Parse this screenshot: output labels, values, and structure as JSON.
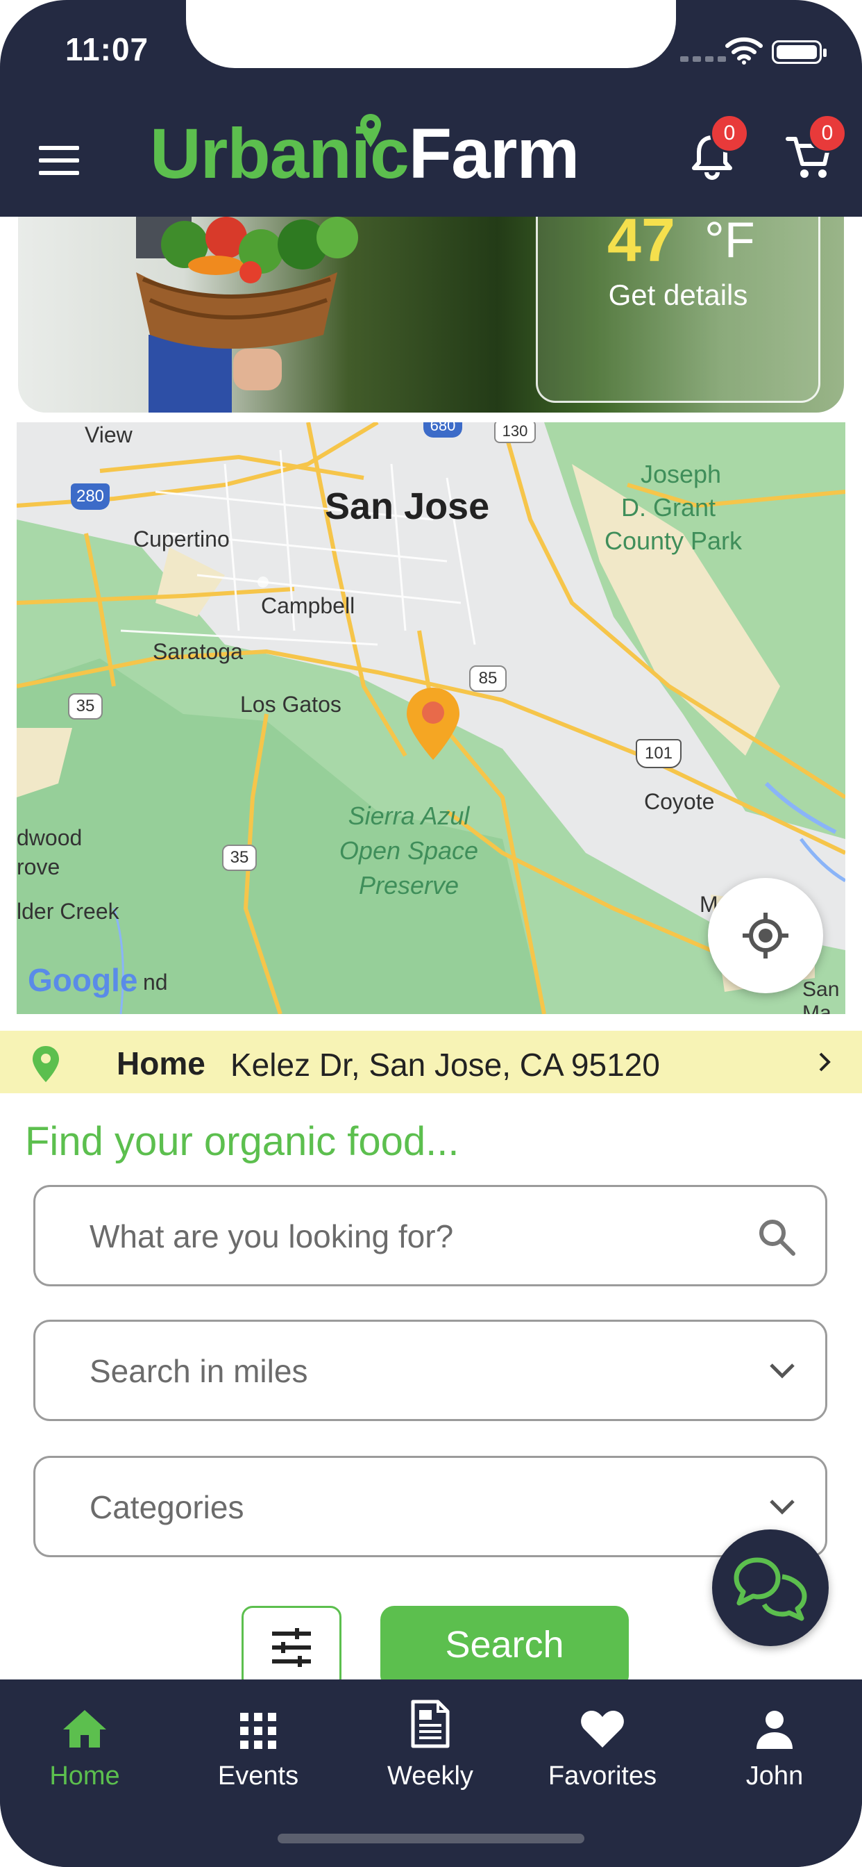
{
  "status_bar": {
    "time": "11:07"
  },
  "header": {
    "logo_part1": "Urbanic",
    "logo_part2": "Farm",
    "notification_count": "0",
    "cart_count": "0"
  },
  "weather": {
    "temperature": "47",
    "unit": "°F",
    "details_label": "Get details"
  },
  "map": {
    "labels": {
      "san_jose": "San Jose",
      "cupertino": "Cupertino",
      "campbell": "Campbell",
      "saratoga": "Saratoga",
      "los_gatos": "Los Gatos",
      "joseph1": "Joseph",
      "joseph2": "D. Grant",
      "joseph3": "County Park",
      "sierra1": "Sierra Azul",
      "sierra2": "Open Space",
      "sierra3": "Preserve",
      "coyote": "Coyote",
      "view": "View",
      "dwood": "dwood",
      "rove": "rove",
      "lder": "lder Creek",
      "nd": "nd",
      "san_ma": "San Ma",
      "m_ll": "M        ll",
      "h280": "280",
      "h130": "130",
      "h85": "85",
      "h35a": "35",
      "h35b": "35",
      "h101": "101",
      "h680": "680",
      "google": "Google"
    }
  },
  "address": {
    "label": "Home",
    "value": "Kelez Dr, San Jose, CA 95120"
  },
  "search": {
    "heading": "Find your organic food...",
    "query_placeholder": "What are you looking for?",
    "miles_placeholder": "Search in miles",
    "categories_placeholder": "Categories",
    "search_button": "Search"
  },
  "tabs": [
    {
      "label": "Home",
      "icon": "home-icon",
      "active": true
    },
    {
      "label": "Events",
      "icon": "grid-icon"
    },
    {
      "label": "Weekly",
      "icon": "document-icon"
    },
    {
      "label": "Favorites",
      "icon": "heart-icon"
    },
    {
      "label": "John",
      "icon": "person-icon"
    }
  ],
  "colors": {
    "accent_green": "#5cbf4e",
    "navy": "#242a42",
    "badge_red": "#e83a3a",
    "address_bar": "#f7f3b5"
  }
}
